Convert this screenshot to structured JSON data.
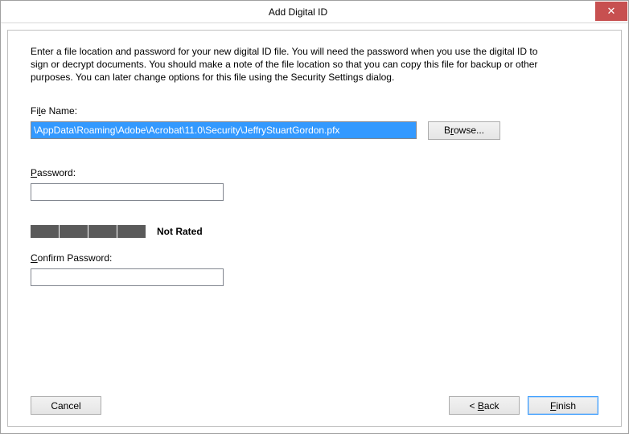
{
  "window": {
    "title": "Add Digital ID"
  },
  "instructions": "Enter a file location and password for your new digital ID file. You will need the password when you use the digital ID to sign or decrypt documents. You should make a note of the file location so that you can copy this file for backup or other purposes. You can later change options for this file using the Security Settings dialog.",
  "fileName": {
    "label": "File Name:",
    "value": "\\AppData\\Roaming\\Adobe\\Acrobat\\11.0\\Security\\JeffryStuartGordon.pfx",
    "browse": "Browse..."
  },
  "password": {
    "label": "Password:",
    "value": "",
    "strengthLabel": "Not Rated"
  },
  "confirm": {
    "label": "Confirm Password:",
    "value": ""
  },
  "buttons": {
    "cancel": "Cancel",
    "back": "< Back",
    "finish": "Finish"
  }
}
